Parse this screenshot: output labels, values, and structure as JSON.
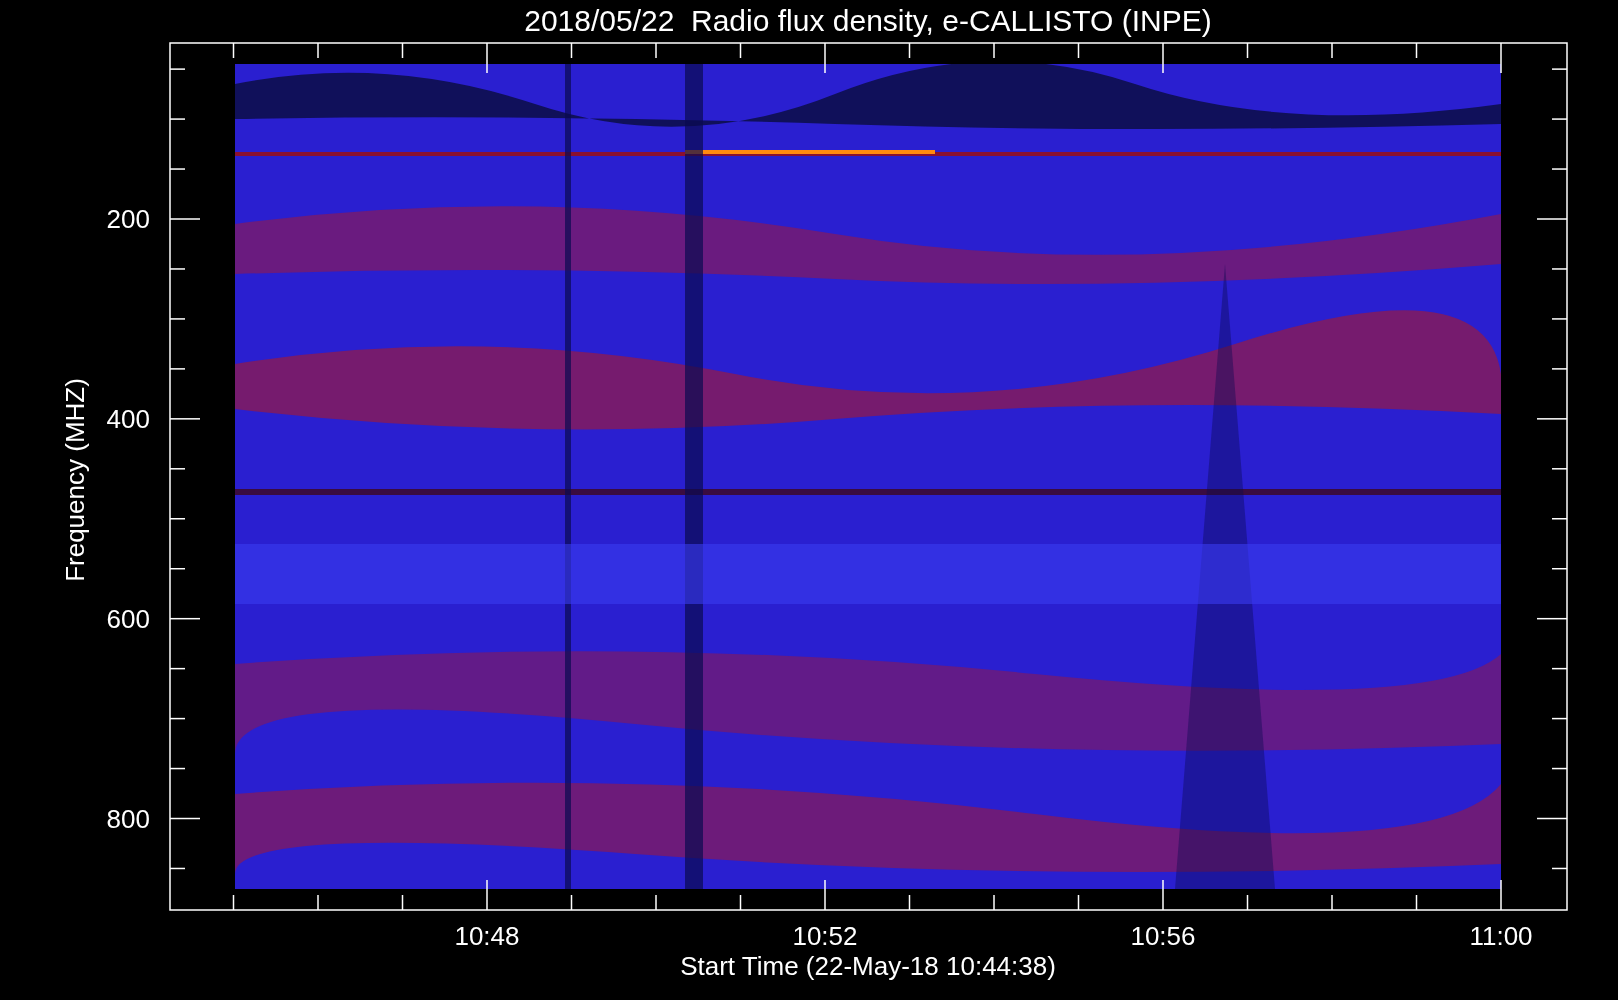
{
  "title": "2018/05/22  Radio flux density, e-CALLISTO (INPE)",
  "y_axis": {
    "label": "Frequency (MHZ)",
    "ticks": [
      "200",
      "400",
      "600",
      "800"
    ]
  },
  "x_axis": {
    "label": "Start Time (22-May-18 10:44:38)",
    "ticks": [
      "10:48",
      "10:52",
      "10:56",
      "11:00"
    ]
  }
}
